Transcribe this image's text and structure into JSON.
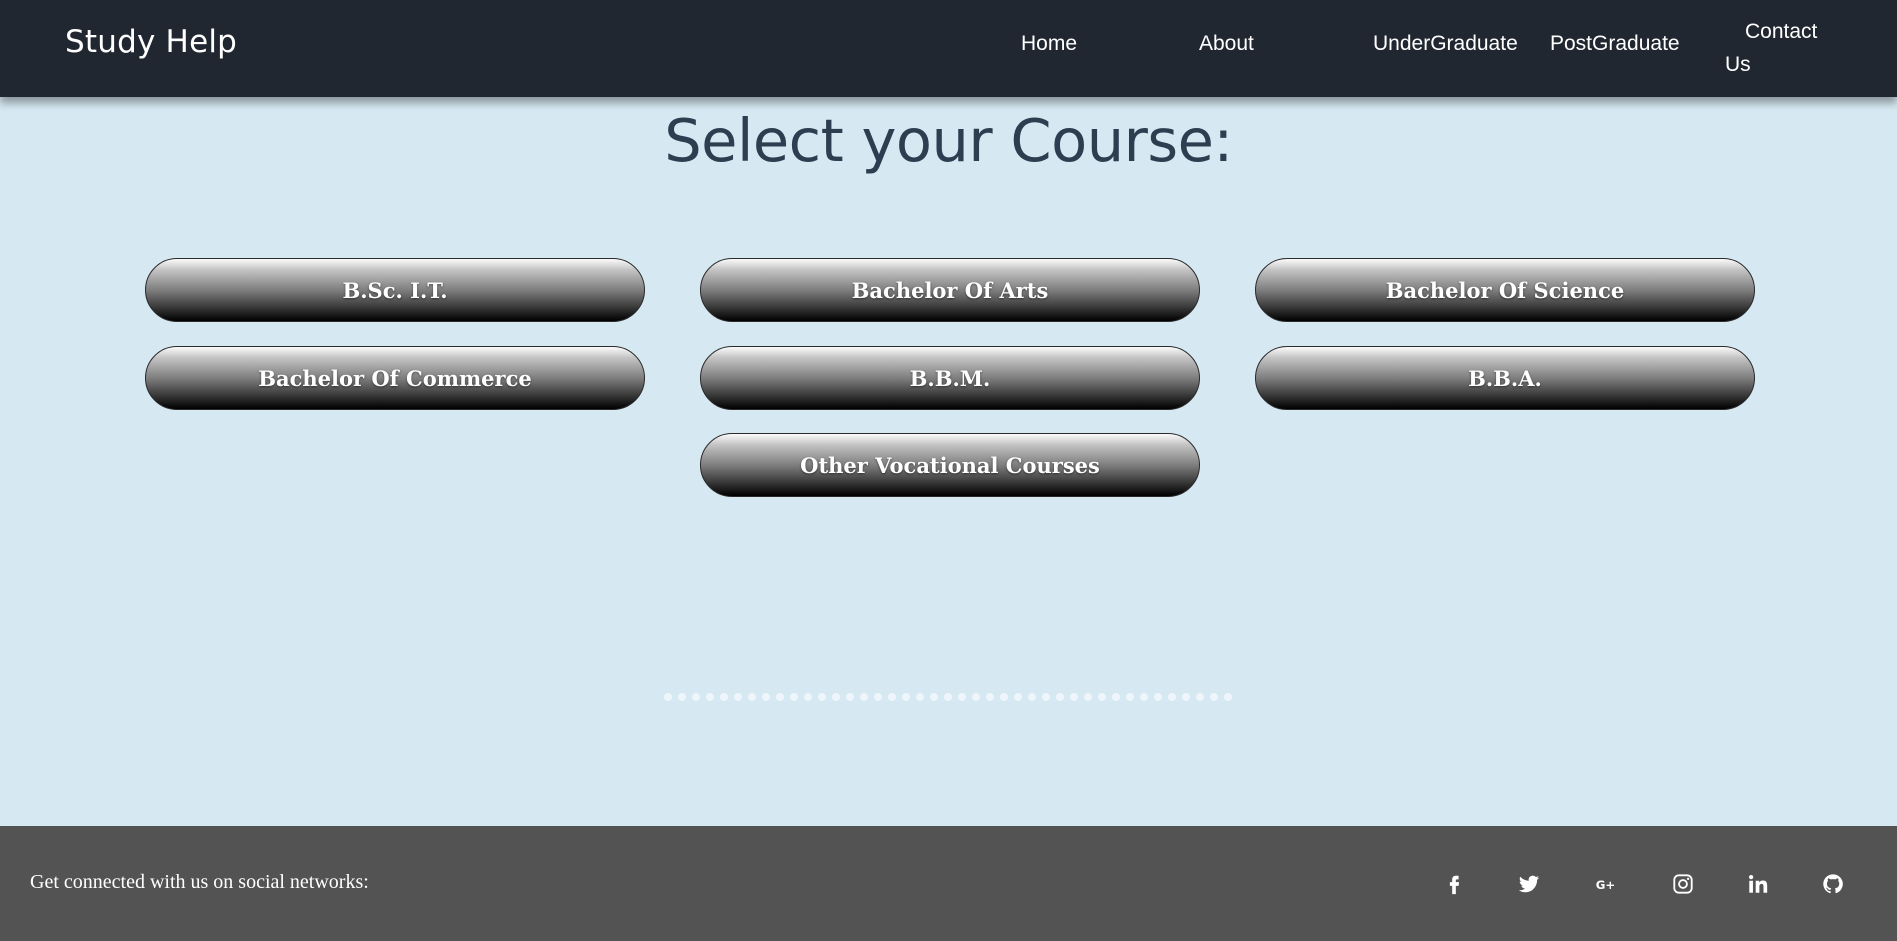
{
  "brand": "Study Help",
  "nav": {
    "home": "Home",
    "about": "About",
    "undergraduate": "UnderGraduate",
    "postgraduate": "PostGraduate",
    "contact": "Contact Us"
  },
  "page_title": "Select your Course:",
  "courses": [
    "B.Sc. I.T.",
    "Bachelor Of Arts",
    "Bachelor Of Science",
    "Bachelor Of Commerce",
    "B.B.M.",
    "B.B.A.",
    "Other Vocational Courses"
  ],
  "footer": {
    "text": "Get connected with us on social networks:",
    "social_icons": [
      "facebook-icon",
      "twitter-icon",
      "google-plus-icon",
      "instagram-icon",
      "linkedin-icon",
      "github-icon"
    ]
  },
  "colors": {
    "navbar_bg": "#212730",
    "page_bg": "#d6e8f2",
    "title_color": "#2c3e50",
    "footer_bg": "#535353"
  }
}
